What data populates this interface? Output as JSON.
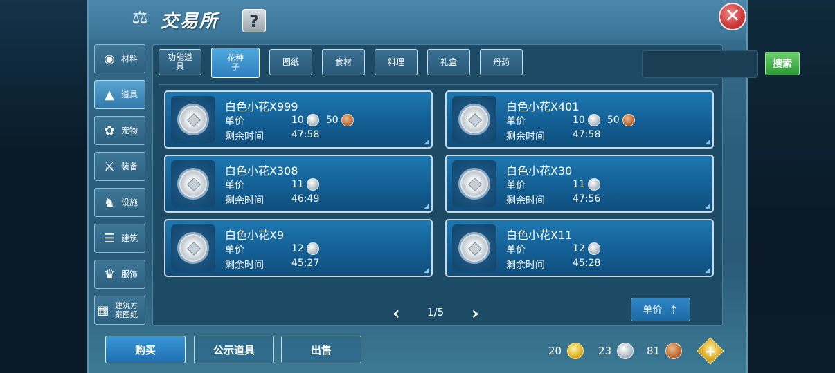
{
  "header": {
    "title": "交易所",
    "help_label": "?",
    "close_label": "✕"
  },
  "sidebar": {
    "items": [
      {
        "label": "材料",
        "icon": "ore-icon",
        "active": false
      },
      {
        "label": "道具",
        "icon": "flask-icon",
        "active": true
      },
      {
        "label": "宠物",
        "icon": "paw-icon",
        "active": false
      },
      {
        "label": "装备",
        "icon": "equipment-icon",
        "active": false
      },
      {
        "label": "设施",
        "icon": "facility-icon",
        "active": false
      },
      {
        "label": "建筑",
        "icon": "building-icon",
        "active": false
      },
      {
        "label": "服饰",
        "icon": "clothing-icon",
        "active": false
      },
      {
        "label": "建筑方案图纸",
        "icon": "blueprint-icon",
        "active": false
      }
    ]
  },
  "tabs": [
    {
      "label": "功能道具",
      "active": false
    },
    {
      "label": "花种子",
      "active": true
    },
    {
      "label": "图纸",
      "active": false
    },
    {
      "label": "食材",
      "active": false
    },
    {
      "label": "料理",
      "active": false
    },
    {
      "label": "礼盒",
      "active": false
    },
    {
      "label": "丹药",
      "active": false
    }
  ],
  "search": {
    "value": "",
    "placeholder": "",
    "button_label": "搜索"
  },
  "labels": {
    "price": "单价",
    "time_left": "剩余时间"
  },
  "items": [
    {
      "name": "白色小花X999",
      "silver": "10",
      "bronze": "50",
      "time": "47:58"
    },
    {
      "name": "白色小花X401",
      "silver": "10",
      "bronze": "50",
      "time": "47:58"
    },
    {
      "name": "白色小花X308",
      "silver": "11",
      "bronze": "",
      "time": "46:49"
    },
    {
      "name": "白色小花X30",
      "silver": "11",
      "bronze": "",
      "time": "47:56"
    },
    {
      "name": "白色小花X9",
      "silver": "12",
      "bronze": "",
      "time": "45:27"
    },
    {
      "name": "白色小花X11",
      "silver": "12",
      "bronze": "",
      "time": "45:28"
    }
  ],
  "pager": {
    "text": "1/5",
    "prev": "‹",
    "next": "›"
  },
  "sort": {
    "label": "单价"
  },
  "bottom": {
    "buy": "购买",
    "public_items": "公示道具",
    "sell": "出售"
  },
  "currency": {
    "gold": "20",
    "silver": "23",
    "bronze": "81",
    "add_label": "+"
  }
}
